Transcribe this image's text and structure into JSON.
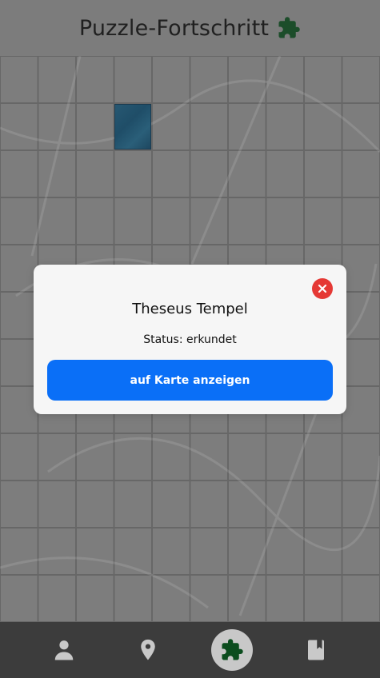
{
  "header": {
    "title": "Puzzle-Fortschritt",
    "icon": "puzzle-icon"
  },
  "modal": {
    "place_name": "Theseus Tempel",
    "status": "Status: erkundet",
    "button_label": "auf Karte anzeigen",
    "close_icon": "close-icon"
  },
  "bottom_nav": {
    "items": [
      {
        "icon": "person-icon",
        "active": false
      },
      {
        "icon": "map-pin-icon",
        "active": false
      },
      {
        "icon": "puzzle-icon",
        "active": true
      },
      {
        "icon": "book-icon",
        "active": false
      }
    ]
  },
  "colors": {
    "accent": "#0a6ff7",
    "close": "#e53935",
    "puzzle_green": "#0b4d1e",
    "nav_bg": "#3c3c3c",
    "piece": "#1a5b7e"
  }
}
